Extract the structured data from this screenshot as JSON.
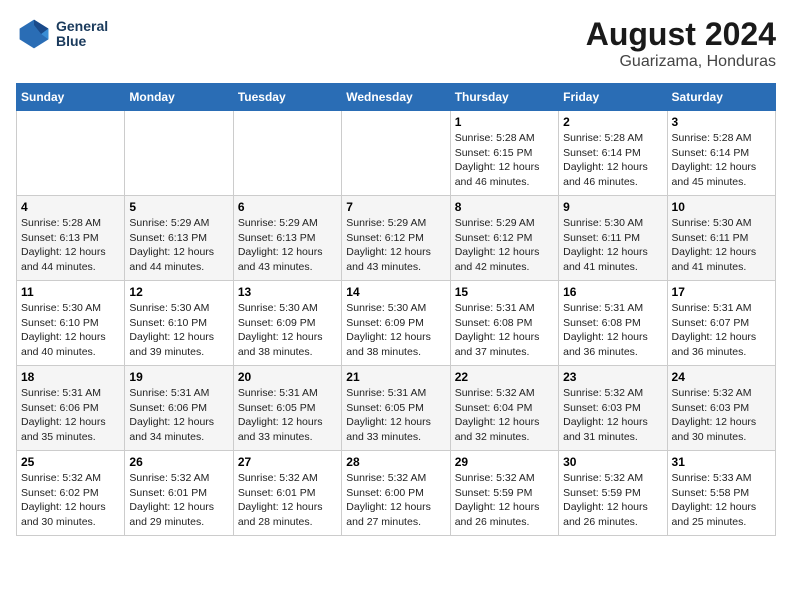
{
  "header": {
    "logo_line1": "General",
    "logo_line2": "Blue",
    "title": "August 2024",
    "subtitle": "Guarizama, Honduras"
  },
  "days_of_week": [
    "Sunday",
    "Monday",
    "Tuesday",
    "Wednesday",
    "Thursday",
    "Friday",
    "Saturday"
  ],
  "weeks": [
    [
      {
        "day": "",
        "info": ""
      },
      {
        "day": "",
        "info": ""
      },
      {
        "day": "",
        "info": ""
      },
      {
        "day": "",
        "info": ""
      },
      {
        "day": "1",
        "info": "Sunrise: 5:28 AM\nSunset: 6:15 PM\nDaylight: 12 hours\nand 46 minutes."
      },
      {
        "day": "2",
        "info": "Sunrise: 5:28 AM\nSunset: 6:14 PM\nDaylight: 12 hours\nand 46 minutes."
      },
      {
        "day": "3",
        "info": "Sunrise: 5:28 AM\nSunset: 6:14 PM\nDaylight: 12 hours\nand 45 minutes."
      }
    ],
    [
      {
        "day": "4",
        "info": "Sunrise: 5:28 AM\nSunset: 6:13 PM\nDaylight: 12 hours\nand 44 minutes."
      },
      {
        "day": "5",
        "info": "Sunrise: 5:29 AM\nSunset: 6:13 PM\nDaylight: 12 hours\nand 44 minutes."
      },
      {
        "day": "6",
        "info": "Sunrise: 5:29 AM\nSunset: 6:13 PM\nDaylight: 12 hours\nand 43 minutes."
      },
      {
        "day": "7",
        "info": "Sunrise: 5:29 AM\nSunset: 6:12 PM\nDaylight: 12 hours\nand 43 minutes."
      },
      {
        "day": "8",
        "info": "Sunrise: 5:29 AM\nSunset: 6:12 PM\nDaylight: 12 hours\nand 42 minutes."
      },
      {
        "day": "9",
        "info": "Sunrise: 5:30 AM\nSunset: 6:11 PM\nDaylight: 12 hours\nand 41 minutes."
      },
      {
        "day": "10",
        "info": "Sunrise: 5:30 AM\nSunset: 6:11 PM\nDaylight: 12 hours\nand 41 minutes."
      }
    ],
    [
      {
        "day": "11",
        "info": "Sunrise: 5:30 AM\nSunset: 6:10 PM\nDaylight: 12 hours\nand 40 minutes."
      },
      {
        "day": "12",
        "info": "Sunrise: 5:30 AM\nSunset: 6:10 PM\nDaylight: 12 hours\nand 39 minutes."
      },
      {
        "day": "13",
        "info": "Sunrise: 5:30 AM\nSunset: 6:09 PM\nDaylight: 12 hours\nand 38 minutes."
      },
      {
        "day": "14",
        "info": "Sunrise: 5:30 AM\nSunset: 6:09 PM\nDaylight: 12 hours\nand 38 minutes."
      },
      {
        "day": "15",
        "info": "Sunrise: 5:31 AM\nSunset: 6:08 PM\nDaylight: 12 hours\nand 37 minutes."
      },
      {
        "day": "16",
        "info": "Sunrise: 5:31 AM\nSunset: 6:08 PM\nDaylight: 12 hours\nand 36 minutes."
      },
      {
        "day": "17",
        "info": "Sunrise: 5:31 AM\nSunset: 6:07 PM\nDaylight: 12 hours\nand 36 minutes."
      }
    ],
    [
      {
        "day": "18",
        "info": "Sunrise: 5:31 AM\nSunset: 6:06 PM\nDaylight: 12 hours\nand 35 minutes."
      },
      {
        "day": "19",
        "info": "Sunrise: 5:31 AM\nSunset: 6:06 PM\nDaylight: 12 hours\nand 34 minutes."
      },
      {
        "day": "20",
        "info": "Sunrise: 5:31 AM\nSunset: 6:05 PM\nDaylight: 12 hours\nand 33 minutes."
      },
      {
        "day": "21",
        "info": "Sunrise: 5:31 AM\nSunset: 6:05 PM\nDaylight: 12 hours\nand 33 minutes."
      },
      {
        "day": "22",
        "info": "Sunrise: 5:32 AM\nSunset: 6:04 PM\nDaylight: 12 hours\nand 32 minutes."
      },
      {
        "day": "23",
        "info": "Sunrise: 5:32 AM\nSunset: 6:03 PM\nDaylight: 12 hours\nand 31 minutes."
      },
      {
        "day": "24",
        "info": "Sunrise: 5:32 AM\nSunset: 6:03 PM\nDaylight: 12 hours\nand 30 minutes."
      }
    ],
    [
      {
        "day": "25",
        "info": "Sunrise: 5:32 AM\nSunset: 6:02 PM\nDaylight: 12 hours\nand 30 minutes."
      },
      {
        "day": "26",
        "info": "Sunrise: 5:32 AM\nSunset: 6:01 PM\nDaylight: 12 hours\nand 29 minutes."
      },
      {
        "day": "27",
        "info": "Sunrise: 5:32 AM\nSunset: 6:01 PM\nDaylight: 12 hours\nand 28 minutes."
      },
      {
        "day": "28",
        "info": "Sunrise: 5:32 AM\nSunset: 6:00 PM\nDaylight: 12 hours\nand 27 minutes."
      },
      {
        "day": "29",
        "info": "Sunrise: 5:32 AM\nSunset: 5:59 PM\nDaylight: 12 hours\nand 26 minutes."
      },
      {
        "day": "30",
        "info": "Sunrise: 5:32 AM\nSunset: 5:59 PM\nDaylight: 12 hours\nand 26 minutes."
      },
      {
        "day": "31",
        "info": "Sunrise: 5:33 AM\nSunset: 5:58 PM\nDaylight: 12 hours\nand 25 minutes."
      }
    ]
  ]
}
